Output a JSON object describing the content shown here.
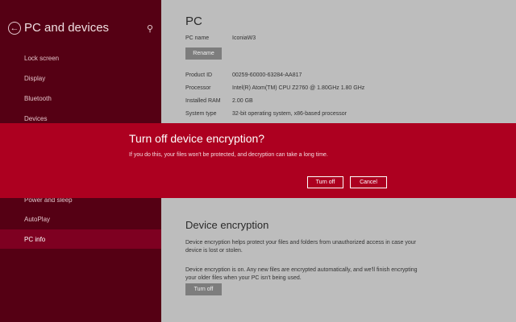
{
  "sidebar": {
    "title": "PC and devices",
    "items": [
      {
        "label": "Lock screen"
      },
      {
        "label": "Display"
      },
      {
        "label": "Bluetooth"
      },
      {
        "label": "Devices"
      },
      {
        "label": "Power and sleep"
      },
      {
        "label": "AutoPlay"
      },
      {
        "label": "PC info"
      }
    ]
  },
  "main": {
    "pc_heading": "PC",
    "pc_name_label": "PC name",
    "pc_name_value": "IconiaW3",
    "rename_label": "Rename",
    "product_id_label": "Product ID",
    "product_id_value": "00259-60000-63284-AA817",
    "processor_label": "Processor",
    "processor_value": "Intel(R) Atom(TM) CPU Z2760 @ 1.80GHz 1.80 GHz",
    "ram_label": "Installed RAM",
    "ram_value": "2.00 GB",
    "system_type_label": "System type",
    "system_type_value": "32-bit operating system, x86-based processor",
    "encryption_heading": "Device encryption",
    "encryption_desc": "Device encryption helps protect your files and folders from unauthorized access in case your device is lost or stolen.",
    "encryption_status": "Device encryption is on. Any new files are encrypted automatically, and we'll finish encrypting your older files when your PC isn't being used.",
    "turn_off_label": "Turn off"
  },
  "dialog": {
    "title": "Turn off device encryption?",
    "message": "If you do this, your files won't be protected, and decryption can take a long time.",
    "confirm_label": "Turn off",
    "cancel_label": "Cancel"
  },
  "colors": {
    "sidebar_bg": "#550014",
    "active_item": "#7e0021",
    "dialog_band": "#ad0020",
    "content_bg": "#bdbdbd"
  }
}
